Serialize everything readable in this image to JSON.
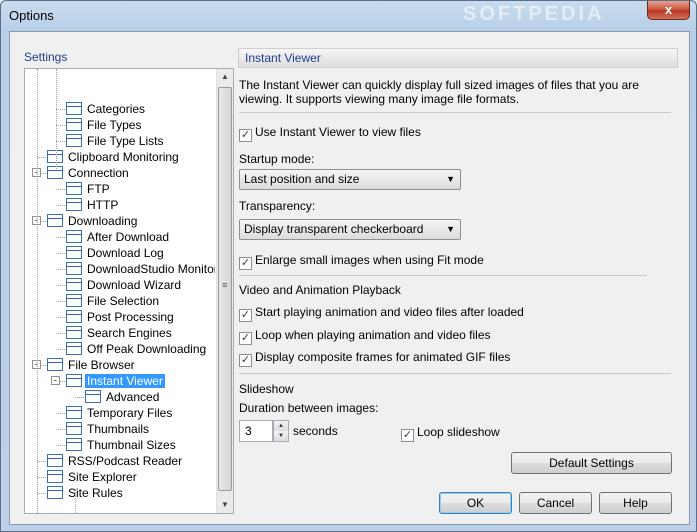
{
  "window": {
    "title": "Options",
    "close_glyph": "x",
    "watermark": "SOFTPEDIA"
  },
  "settings": {
    "label": "Settings",
    "tree": [
      {
        "label": "Categories",
        "level": 2
      },
      {
        "label": "File Types",
        "level": 2
      },
      {
        "label": "File Type Lists",
        "level": 2
      },
      {
        "label": "Clipboard Monitoring",
        "level": 1
      },
      {
        "label": "Connection",
        "level": 1,
        "expander": "-"
      },
      {
        "label": "FTP",
        "level": 2
      },
      {
        "label": "HTTP",
        "level": 2
      },
      {
        "label": "Downloading",
        "level": 1,
        "expander": "-"
      },
      {
        "label": "After Download",
        "level": 2
      },
      {
        "label": "Download Log",
        "level": 2
      },
      {
        "label": "DownloadStudio Monitor",
        "level": 2
      },
      {
        "label": "Download Wizard",
        "level": 2
      },
      {
        "label": "File Selection",
        "level": 2
      },
      {
        "label": "Post Processing",
        "level": 2
      },
      {
        "label": "Search Engines",
        "level": 2
      },
      {
        "label": "Off Peak Downloading",
        "level": 2
      },
      {
        "label": "File Browser",
        "level": 1,
        "expander": "-"
      },
      {
        "label": "Instant Viewer",
        "level": 2,
        "expander": "-",
        "selected": true
      },
      {
        "label": "Advanced",
        "level": 3
      },
      {
        "label": "Temporary Files",
        "level": 2
      },
      {
        "label": "Thumbnails",
        "level": 2
      },
      {
        "label": "Thumbnail Sizes",
        "level": 2
      },
      {
        "label": "RSS/Podcast Reader",
        "level": 1
      },
      {
        "label": "Site Explorer",
        "level": 1
      },
      {
        "label": "Site Rules",
        "level": 1
      }
    ],
    "scroll_position": 0.62
  },
  "panel": {
    "header": "Instant Viewer",
    "description": "The Instant Viewer can quickly display full sized images of files that you are viewing.  It supports viewing many image file formats.",
    "use_instant_viewer": {
      "label": "Use Instant Viewer to view files",
      "checked": true
    },
    "startup_mode": {
      "label": "Startup mode:",
      "value": "Last position and size"
    },
    "transparency": {
      "label": "Transparency:",
      "value": "Display transparent checkerboard"
    },
    "enlarge_small": {
      "label": "Enlarge small images when using Fit mode",
      "checked": true
    },
    "video_section": {
      "title": "Video and Animation Playback",
      "start_playing": {
        "label": "Start playing animation and video files after loaded",
        "checked": true
      },
      "loop_playing": {
        "label": "Loop when playing animation and video files",
        "checked": true
      },
      "composite_frames": {
        "label": "Display composite frames for animated GIF files",
        "checked": true
      }
    },
    "slideshow": {
      "title": "Slideshow",
      "duration_label": "Duration between images:",
      "duration_value": "3",
      "seconds_label": "seconds",
      "loop": {
        "label": "Loop slideshow",
        "checked": true
      }
    },
    "default_settings_label": "Default Settings"
  },
  "buttons": {
    "ok": "OK",
    "cancel": "Cancel",
    "help": "Help"
  },
  "check_glyph": "✓"
}
